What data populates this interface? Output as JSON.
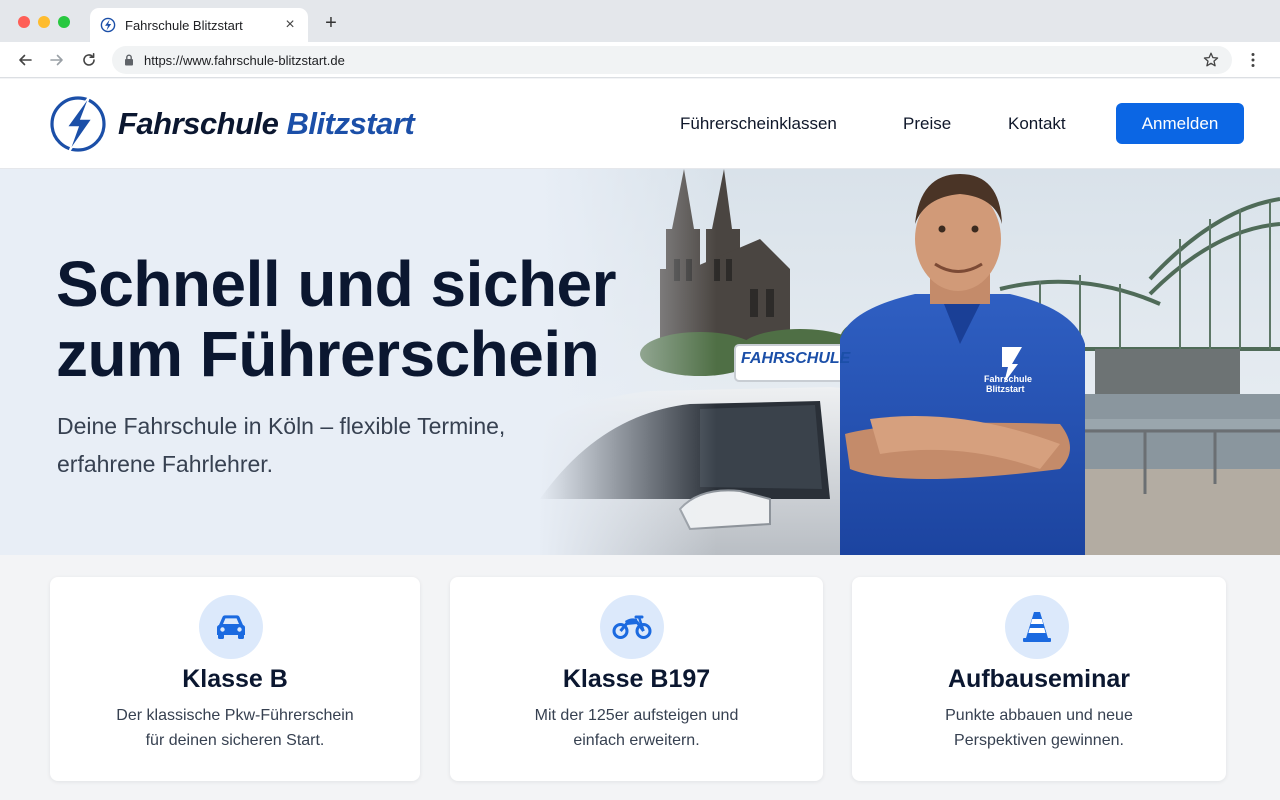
{
  "browser": {
    "tab_title": "Fahrschule Blitzstart",
    "tab_close": "×",
    "new_tab": "+",
    "url": "https://www.fahrschule-blitzstart.de"
  },
  "header": {
    "logo_part1": "Fahrschule",
    "logo_part2": "Blitzstart",
    "nav": [
      "Führerscheinklassen",
      "Preise",
      "Kontakt"
    ],
    "cta_label": "Anmelden"
  },
  "hero": {
    "title_line1": "Schnell und sicher",
    "title_line2": "zum Führerschein",
    "subtitle_line1": "Deine Fahrschule in Köln – flexible Termine,",
    "subtitle_line2": "erfahrene Fahrlehrer.",
    "car_roof_sign": "FAHRSCHULE",
    "shirt_logo_line1": "Fahrschule",
    "shirt_logo_line2": "Blitzstart"
  },
  "cards": [
    {
      "icon": "car-icon",
      "title": "Klasse B",
      "text_line1": "Der klassische Pkw-Führerschein",
      "text_line2": "für deinen sicheren Start."
    },
    {
      "icon": "motorcycle-icon",
      "title": "Klasse B197",
      "text_line1": "Mit der 125er aufsteigen und",
      "text_line2": "einfach erweitern."
    },
    {
      "icon": "traffic-cone-icon",
      "title": "Aufbauseminar",
      "text_line1": "Punkte abbauen und neue",
      "text_line2": "Perspektiven gewinnen."
    }
  ],
  "colors": {
    "brand_dark": "#0b1730",
    "brand_blue": "#1b4fa8",
    "cta_blue": "#0b66e4",
    "icon_bg": "#dce9fb"
  }
}
